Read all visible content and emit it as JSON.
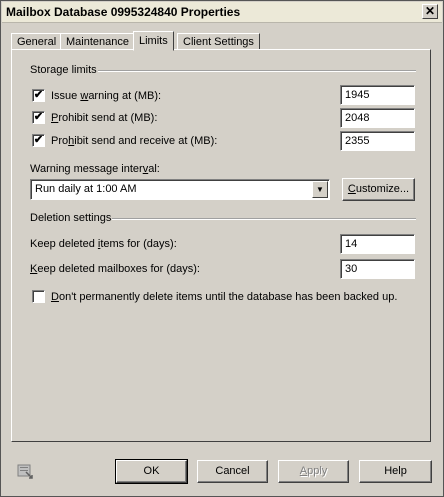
{
  "window": {
    "title": "Mailbox Database 0995324840 Properties",
    "close_glyph": "✕"
  },
  "tabs": [
    {
      "label": "General",
      "active": false
    },
    {
      "label": "Maintenance",
      "active": false
    },
    {
      "label": "Limits",
      "active": true
    },
    {
      "label": "Client Settings",
      "active": false
    }
  ],
  "storage": {
    "section_label": "Storage limits",
    "issue_warning": {
      "pre": "Issue ",
      "ul": "w",
      "post": "arning at (MB):",
      "checked": true,
      "value": "1945"
    },
    "prohibit_send": {
      "pre": "",
      "ul": "P",
      "post": "rohibit send at (MB):",
      "checked": true,
      "value": "2048"
    },
    "prohibit_send_receive": {
      "pre": "Pro",
      "ul": "h",
      "post": "ibit send and receive at (MB):",
      "checked": true,
      "value": "2355"
    }
  },
  "warning_interval": {
    "label_pre": "Warning message inter",
    "label_ul": "v",
    "label_post": "al:",
    "selected": "Run daily at 1:00 AM",
    "customize_pre": "",
    "customize_ul": "C",
    "customize_post": "ustomize..."
  },
  "deletion": {
    "section_label": "Deletion settings",
    "keep_items": {
      "pre": "Keep deleted ",
      "ul": "i",
      "post": "tems for (days):",
      "value": "14"
    },
    "keep_mailboxes": {
      "pre": "",
      "ul": "K",
      "post": "eep deleted mailboxes for (days):",
      "value": "30"
    },
    "backup_check": {
      "pre": "",
      "ul": "D",
      "post": "on't permanently delete items until the database has been backed up.",
      "checked": false
    }
  },
  "buttons": {
    "ok": "OK",
    "cancel": "Cancel",
    "apply_pre": "",
    "apply_ul": "A",
    "apply_post": "pply",
    "help": "Help"
  },
  "check_glyph": "✔"
}
